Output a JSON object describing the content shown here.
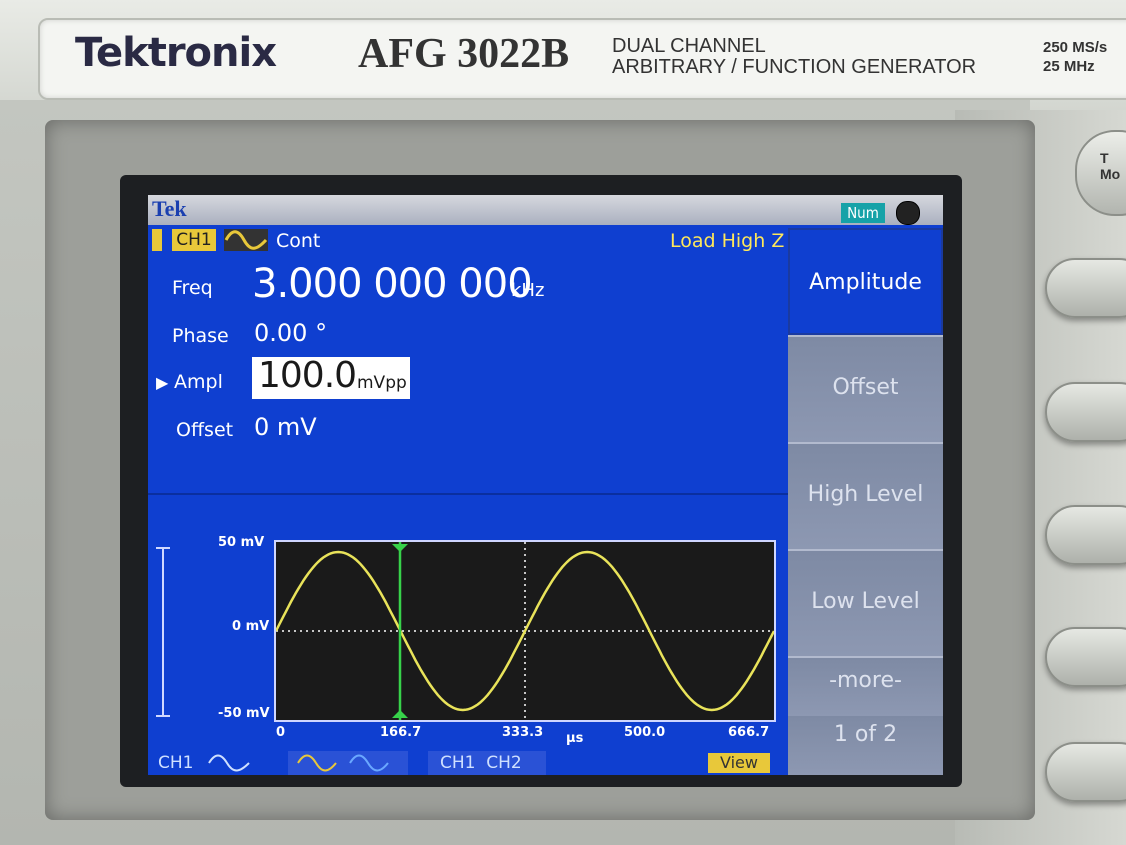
{
  "instrument": {
    "brand": "Tektronix",
    "model": "AFG 3022B",
    "description_line1": "DUAL CHANNEL",
    "description_line2": "ARBITRARY / FUNCTION GENERATOR",
    "spec_line1": "250 MS/s",
    "spec_line2": "25 MHz",
    "top_button_label_line1": "T",
    "top_button_label_line2": "Mo"
  },
  "screen": {
    "logo": "Tek",
    "num_indicator": "Num",
    "channel": "CH1",
    "waveform_icon": "sine-icon",
    "run_mode": "Cont",
    "load": "Load High Z",
    "params": {
      "freq_label": "Freq",
      "freq_value": "3.000 000 000",
      "freq_unit": "kHz",
      "phase_label": "Phase",
      "phase_value": "0.00 °",
      "ampl_label": "Ampl",
      "ampl_value": "100.0",
      "ampl_unit": "mVpp",
      "offset_label": "Offset",
      "offset_value": "0 mV"
    },
    "menu": [
      "Amplitude",
      "Offset",
      "High Level",
      "Low Level",
      "-more-",
      "1 of 2"
    ],
    "graph": {
      "y_top": "50 mV",
      "y_mid": "0 mV",
      "y_bot": "-50 mV",
      "x_ticks": [
        "0",
        "166.7",
        "333.3",
        "500.0",
        "666.7"
      ],
      "x_unit": "µs",
      "wave_color": "#e9e35a",
      "cursor_color": "#37d24a"
    },
    "tabs": {
      "ch1": "CH1",
      "ch1_ch2": "CH1  CH2",
      "view": "View"
    },
    "colors": {
      "screen_bg": "#0f3fd0",
      "menu_bg": "#8690aa",
      "highlight": "#e8c83a",
      "load_text": "#ffe85a"
    }
  }
}
